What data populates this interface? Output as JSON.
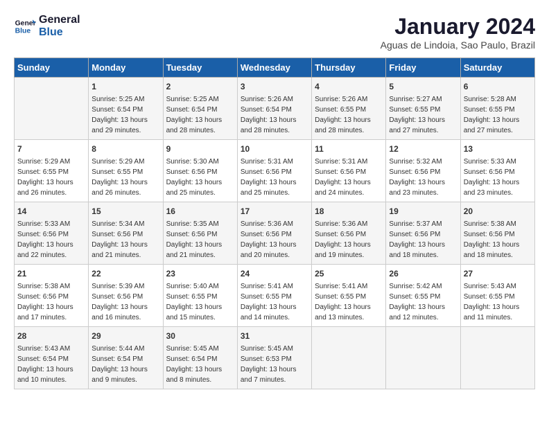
{
  "header": {
    "logo_line1": "General",
    "logo_line2": "Blue",
    "month": "January 2024",
    "location": "Aguas de Lindoia, Sao Paulo, Brazil"
  },
  "days_of_week": [
    "Sunday",
    "Monday",
    "Tuesday",
    "Wednesday",
    "Thursday",
    "Friday",
    "Saturday"
  ],
  "weeks": [
    [
      {
        "day": "",
        "info": ""
      },
      {
        "day": "1",
        "info": "Sunrise: 5:25 AM\nSunset: 6:54 PM\nDaylight: 13 hours\nand 29 minutes."
      },
      {
        "day": "2",
        "info": "Sunrise: 5:25 AM\nSunset: 6:54 PM\nDaylight: 13 hours\nand 28 minutes."
      },
      {
        "day": "3",
        "info": "Sunrise: 5:26 AM\nSunset: 6:54 PM\nDaylight: 13 hours\nand 28 minutes."
      },
      {
        "day": "4",
        "info": "Sunrise: 5:26 AM\nSunset: 6:55 PM\nDaylight: 13 hours\nand 28 minutes."
      },
      {
        "day": "5",
        "info": "Sunrise: 5:27 AM\nSunset: 6:55 PM\nDaylight: 13 hours\nand 27 minutes."
      },
      {
        "day": "6",
        "info": "Sunrise: 5:28 AM\nSunset: 6:55 PM\nDaylight: 13 hours\nand 27 minutes."
      }
    ],
    [
      {
        "day": "7",
        "info": "Sunrise: 5:29 AM\nSunset: 6:55 PM\nDaylight: 13 hours\nand 26 minutes."
      },
      {
        "day": "8",
        "info": "Sunrise: 5:29 AM\nSunset: 6:55 PM\nDaylight: 13 hours\nand 26 minutes."
      },
      {
        "day": "9",
        "info": "Sunrise: 5:30 AM\nSunset: 6:56 PM\nDaylight: 13 hours\nand 25 minutes."
      },
      {
        "day": "10",
        "info": "Sunrise: 5:31 AM\nSunset: 6:56 PM\nDaylight: 13 hours\nand 25 minutes."
      },
      {
        "day": "11",
        "info": "Sunrise: 5:31 AM\nSunset: 6:56 PM\nDaylight: 13 hours\nand 24 minutes."
      },
      {
        "day": "12",
        "info": "Sunrise: 5:32 AM\nSunset: 6:56 PM\nDaylight: 13 hours\nand 23 minutes."
      },
      {
        "day": "13",
        "info": "Sunrise: 5:33 AM\nSunset: 6:56 PM\nDaylight: 13 hours\nand 23 minutes."
      }
    ],
    [
      {
        "day": "14",
        "info": "Sunrise: 5:33 AM\nSunset: 6:56 PM\nDaylight: 13 hours\nand 22 minutes."
      },
      {
        "day": "15",
        "info": "Sunrise: 5:34 AM\nSunset: 6:56 PM\nDaylight: 13 hours\nand 21 minutes."
      },
      {
        "day": "16",
        "info": "Sunrise: 5:35 AM\nSunset: 6:56 PM\nDaylight: 13 hours\nand 21 minutes."
      },
      {
        "day": "17",
        "info": "Sunrise: 5:36 AM\nSunset: 6:56 PM\nDaylight: 13 hours\nand 20 minutes."
      },
      {
        "day": "18",
        "info": "Sunrise: 5:36 AM\nSunset: 6:56 PM\nDaylight: 13 hours\nand 19 minutes."
      },
      {
        "day": "19",
        "info": "Sunrise: 5:37 AM\nSunset: 6:56 PM\nDaylight: 13 hours\nand 18 minutes."
      },
      {
        "day": "20",
        "info": "Sunrise: 5:38 AM\nSunset: 6:56 PM\nDaylight: 13 hours\nand 18 minutes."
      }
    ],
    [
      {
        "day": "21",
        "info": "Sunrise: 5:38 AM\nSunset: 6:56 PM\nDaylight: 13 hours\nand 17 minutes."
      },
      {
        "day": "22",
        "info": "Sunrise: 5:39 AM\nSunset: 6:56 PM\nDaylight: 13 hours\nand 16 minutes."
      },
      {
        "day": "23",
        "info": "Sunrise: 5:40 AM\nSunset: 6:55 PM\nDaylight: 13 hours\nand 15 minutes."
      },
      {
        "day": "24",
        "info": "Sunrise: 5:41 AM\nSunset: 6:55 PM\nDaylight: 13 hours\nand 14 minutes."
      },
      {
        "day": "25",
        "info": "Sunrise: 5:41 AM\nSunset: 6:55 PM\nDaylight: 13 hours\nand 13 minutes."
      },
      {
        "day": "26",
        "info": "Sunrise: 5:42 AM\nSunset: 6:55 PM\nDaylight: 13 hours\nand 12 minutes."
      },
      {
        "day": "27",
        "info": "Sunrise: 5:43 AM\nSunset: 6:55 PM\nDaylight: 13 hours\nand 11 minutes."
      }
    ],
    [
      {
        "day": "28",
        "info": "Sunrise: 5:43 AM\nSunset: 6:54 PM\nDaylight: 13 hours\nand 10 minutes."
      },
      {
        "day": "29",
        "info": "Sunrise: 5:44 AM\nSunset: 6:54 PM\nDaylight: 13 hours\nand 9 minutes."
      },
      {
        "day": "30",
        "info": "Sunrise: 5:45 AM\nSunset: 6:54 PM\nDaylight: 13 hours\nand 8 minutes."
      },
      {
        "day": "31",
        "info": "Sunrise: 5:45 AM\nSunset: 6:53 PM\nDaylight: 13 hours\nand 7 minutes."
      },
      {
        "day": "",
        "info": ""
      },
      {
        "day": "",
        "info": ""
      },
      {
        "day": "",
        "info": ""
      }
    ]
  ]
}
